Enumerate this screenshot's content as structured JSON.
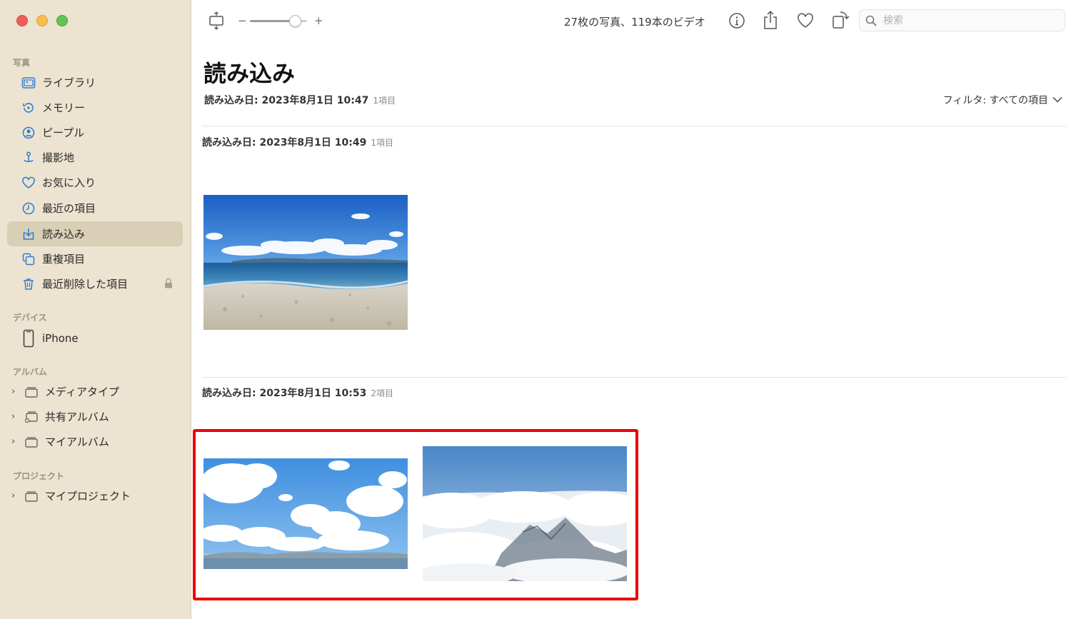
{
  "sidebar": {
    "sections": {
      "photos": "写真",
      "devices": "デバイス",
      "albums": "アルバム",
      "projects": "プロジェクト"
    },
    "items": [
      {
        "label": "ライブラリ",
        "icon": "library-icon"
      },
      {
        "label": "メモリー",
        "icon": "memories-icon"
      },
      {
        "label": "ピープル",
        "icon": "people-icon"
      },
      {
        "label": "撮影地",
        "icon": "places-icon"
      },
      {
        "label": "お気に入り",
        "icon": "heart-icon"
      },
      {
        "label": "最近の項目",
        "icon": "clock-icon"
      },
      {
        "label": "読み込み",
        "icon": "import-icon",
        "selected": true
      },
      {
        "label": "重複項目",
        "icon": "duplicates-icon"
      },
      {
        "label": "最近削除した項目",
        "icon": "trash-icon",
        "locked": true
      }
    ],
    "device": {
      "label": "iPhone",
      "icon": "iphone-icon"
    },
    "albums": [
      {
        "label": "メディアタイプ"
      },
      {
        "label": "共有アルバム"
      },
      {
        "label": "マイアルバム"
      }
    ],
    "projects": [
      {
        "label": "マイプロジェクト"
      }
    ]
  },
  "toolbar": {
    "count_text": "27枚の写真、119本のビデオ",
    "zoom_minus": "−",
    "zoom_plus": "+",
    "zoom_level": 0.78,
    "search_placeholder": "検索"
  },
  "main": {
    "title": "読み込み",
    "filter_label": "フィルタ: すべての項目",
    "groups": [
      {
        "date": "読み込み日: 2023年8月1日 10:47",
        "count": "1項目"
      },
      {
        "date": "読み込み日: 2023年8月1日 10:49",
        "count": "1項目"
      },
      {
        "date": "読み込み日: 2023年8月1日 10:53",
        "count": "2項目"
      }
    ]
  },
  "colors": {
    "sidebar_bg": "#ece3d0",
    "selected_bg": "#d9cfb6",
    "accent_icon": "#2f7fd6",
    "highlight": "#ee0000"
  }
}
